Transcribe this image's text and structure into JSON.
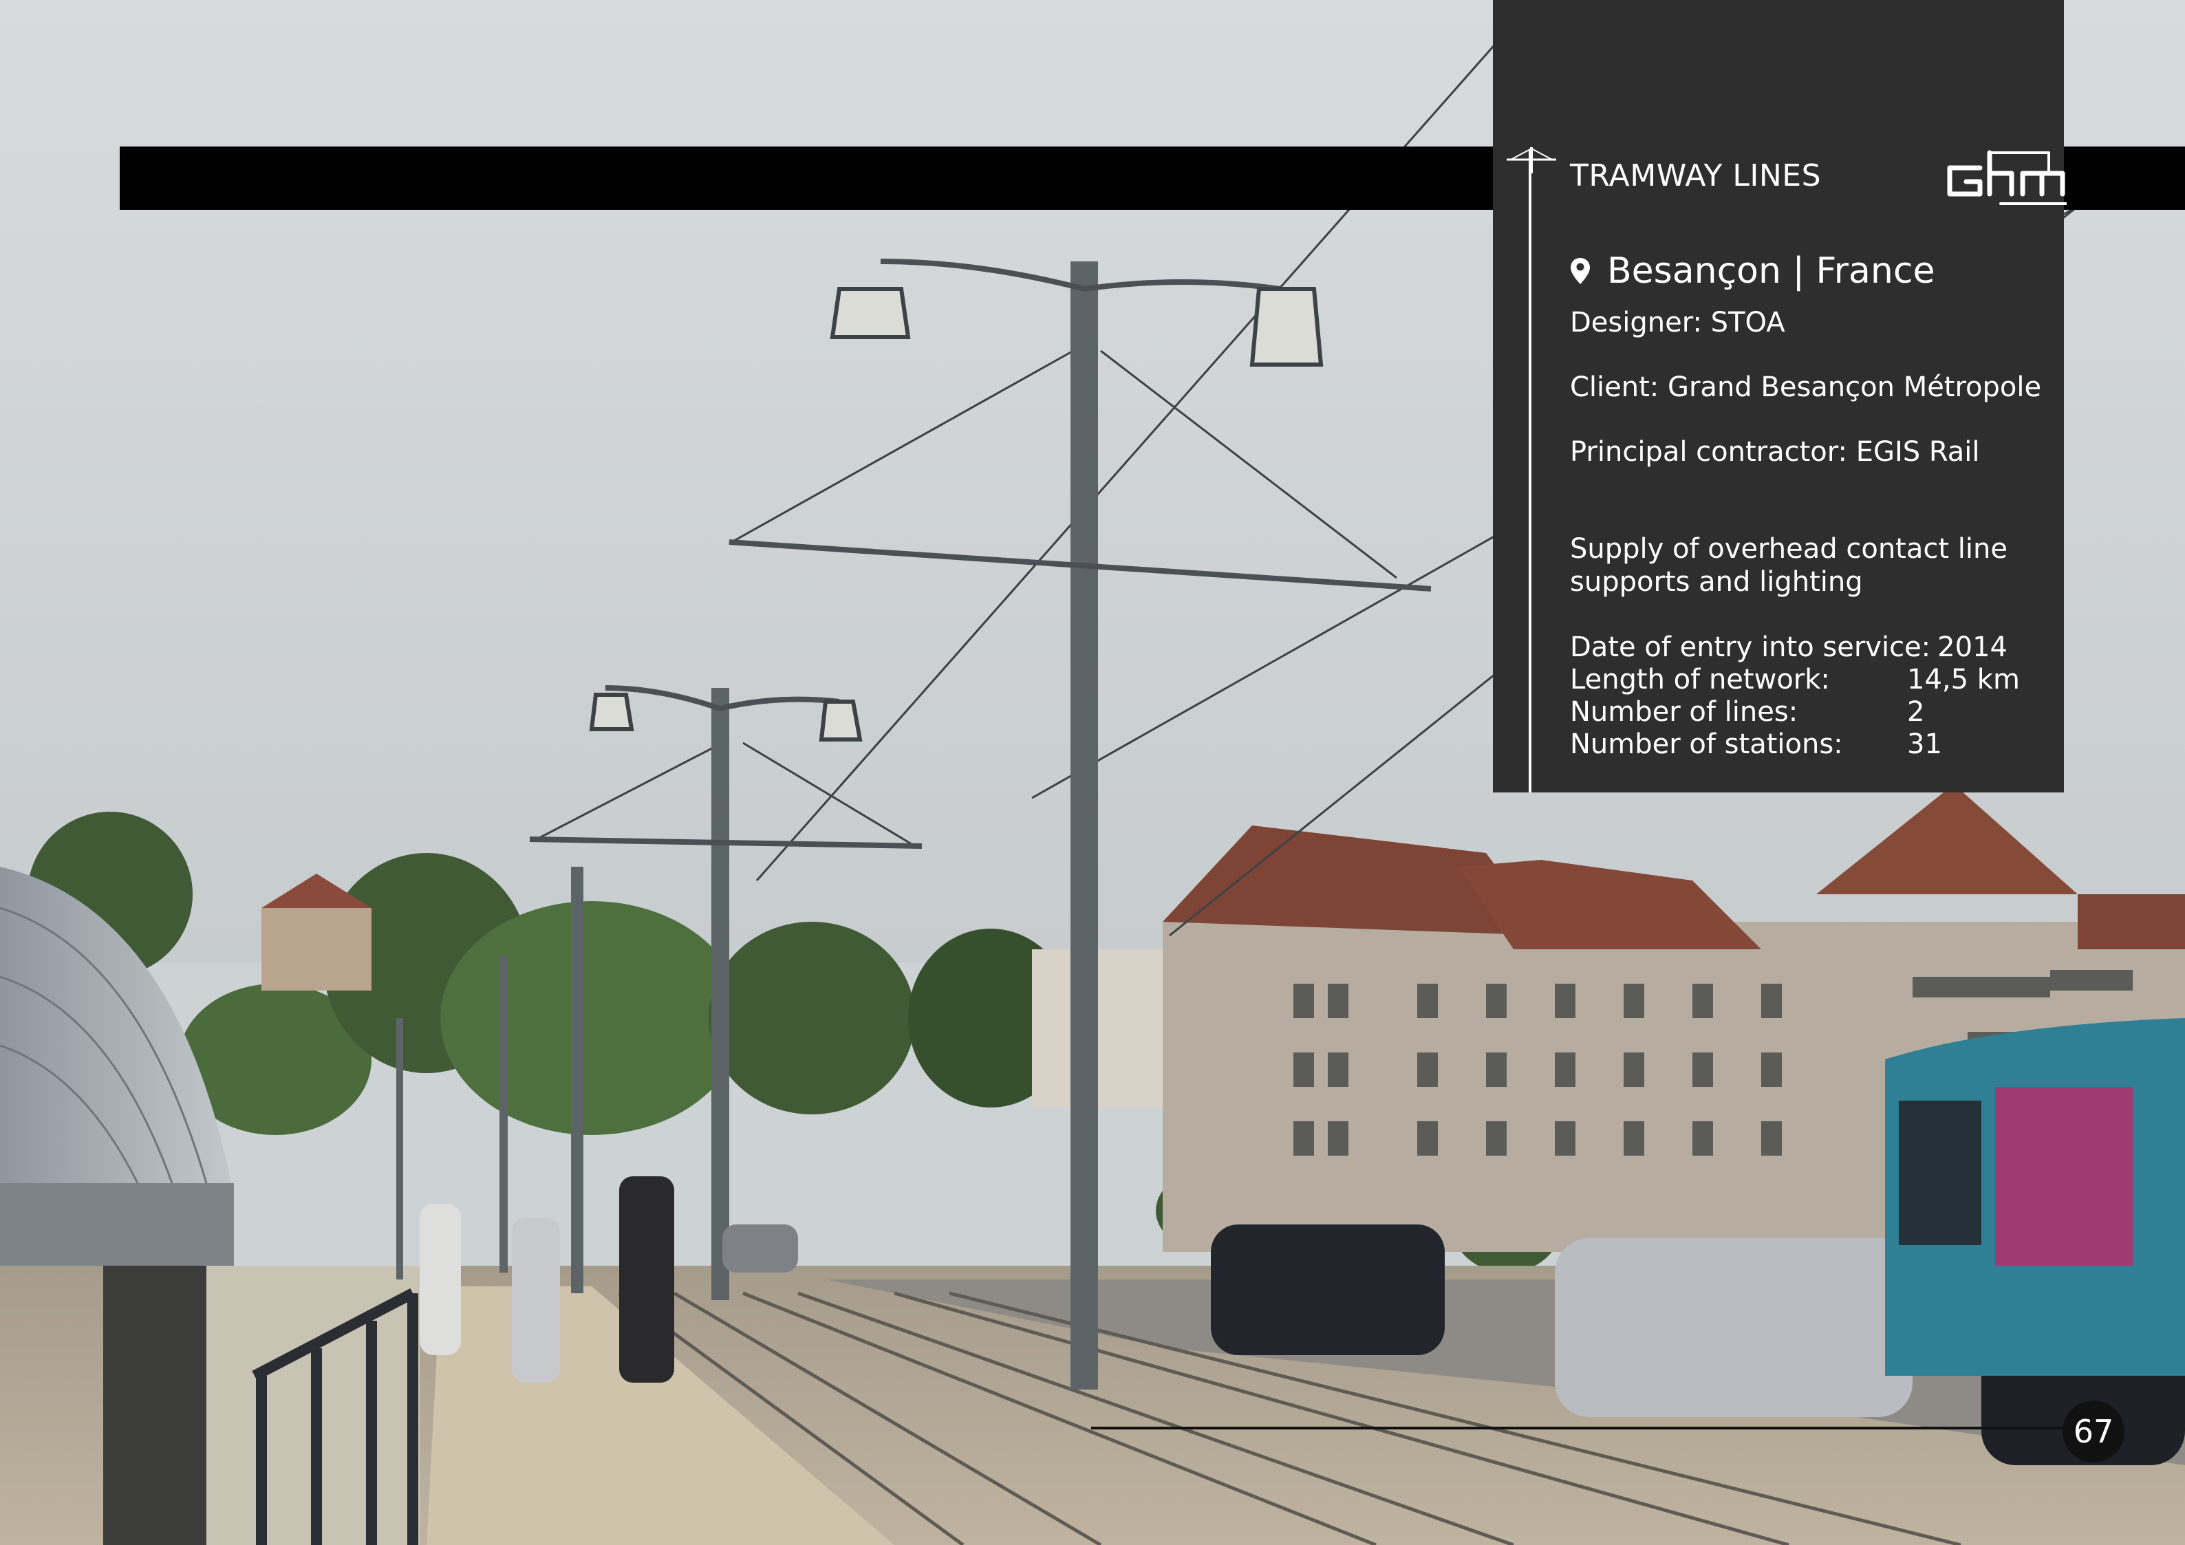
{
  "header": {
    "section_title": "TRAMWAY LINES",
    "logo_text": "Ghm"
  },
  "project": {
    "location": "Besançon | France",
    "designer": "Designer: STOA",
    "client": "Client: Grand Besançon Métropole",
    "contractor": "Principal contractor: EGIS Rail",
    "description": "Supply of overhead contact line supports and lighting"
  },
  "stats": [
    {
      "label": "Date of entry into service:",
      "value": "2014"
    },
    {
      "label": "Length of network:",
      "value": "14,5 km"
    },
    {
      "label": "Number of lines:",
      "value": "2"
    },
    {
      "label": "Number of stations:",
      "value": "31"
    }
  ],
  "footer": {
    "page_number": "67"
  },
  "colors": {
    "panel": "#2e2e2e",
    "bar": "#000000",
    "text": "#ffffff"
  },
  "icons": [
    "location-pin-icon",
    "catenary-mast-icon"
  ]
}
